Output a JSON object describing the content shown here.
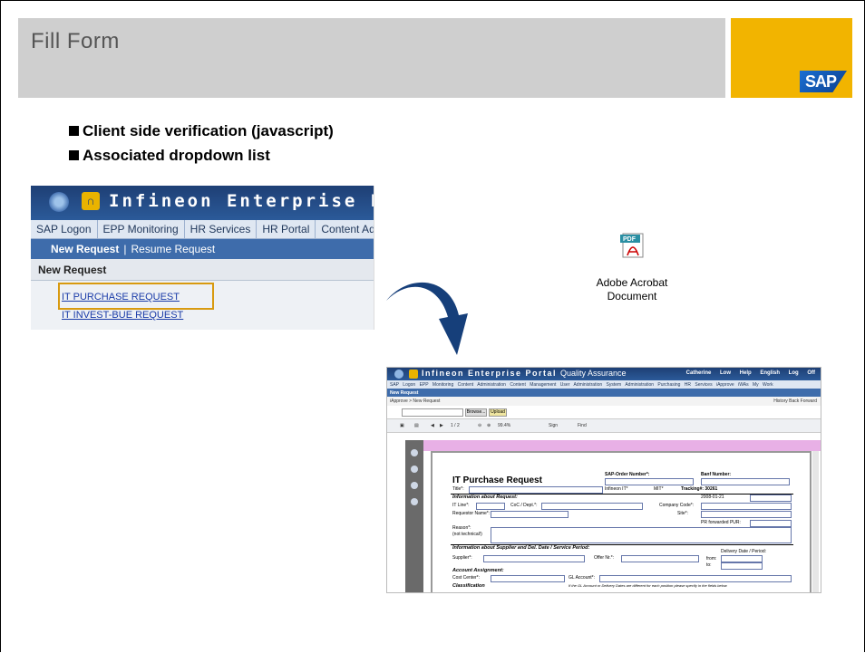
{
  "slide": {
    "title": "Fill Form",
    "logo_text": "SAP",
    "bullets": [
      "Client side verification (javascript)",
      "Associated dropdown list"
    ],
    "colors": {
      "accent": "#f2b400",
      "title_bar": "#cfcfcf",
      "highlight": "#d89a10",
      "arrow": "#163f7a"
    }
  },
  "portal": {
    "brand": "Infineon Enterprise P",
    "tabs": [
      "SAP Logon",
      "EPP Monitoring",
      "HR Services",
      "HR Portal",
      "Content Admi"
    ],
    "subnav": {
      "active": "New Request",
      "separator": "|",
      "other": "Resume Request"
    },
    "page_heading": "New Request",
    "links": [
      "IT PURCHASE REQUEST",
      "IT INVEST-BUE REQUEST"
    ]
  },
  "pdf_icon": {
    "badge": "PDF",
    "caption_line1": "Adobe Acrobat",
    "caption_line2": "Document"
  },
  "screenshot": {
    "brand": "Infineon Enterprise Portal",
    "qa": "Quality Assurance",
    "header_right": "Catherine Low  Help  English  Log Off",
    "tabs_text": "SAP Logon  EPP Monitoring  Content Administration  Content Management  User Administration  System Administration  Purchasing  HR Services  iApprove  iWAs  My Work",
    "subnav": "New Request",
    "breadcrumb": "iApprove > New Request",
    "history": "History  Back  Forward",
    "browse_label": "Browse...",
    "upload_label": "Upload",
    "page_indicator": "1 / 2",
    "zoom": "99.4%",
    "sign_label": "Sign",
    "find_label": "Find",
    "form": {
      "title": "IT Purchase Request",
      "sap_order_label": "SAP-Order Number*:",
      "banf_label": "Banf Number:",
      "title_label": "Title*:",
      "infineon_it": "Infineon IT*",
      "mit": "MIT*",
      "tracking": "Tracking#: 30261",
      "date": "2008-01-21",
      "sec_request": "Information about Request:",
      "it_line": "IT Line*:",
      "coc_dept": "CoC / Dept.*:",
      "company_code": "Company Code*:",
      "requestor": "Requestor Name*:",
      "site": "Site*:",
      "pr_forwarded": "PR forwarded PUR:",
      "reason": "Reason*:",
      "reason_note": "(not technical!)",
      "sec_supplier": "Information about Supplier and Del. Date / Service Period:",
      "supplier": "Supplier*:",
      "offer_nr": "Offer Nr.*:",
      "delivery": "Delivery Date / Period:",
      "from": "from:",
      "to": "to:",
      "sec_account": "Account Assignment:",
      "cost_center": "Cost Center*:",
      "gl_account": "GL Account*:",
      "sec_class": "Classification",
      "note": "If the GL Account or Delivery Dates are different for each position please specify in the fields below"
    }
  }
}
